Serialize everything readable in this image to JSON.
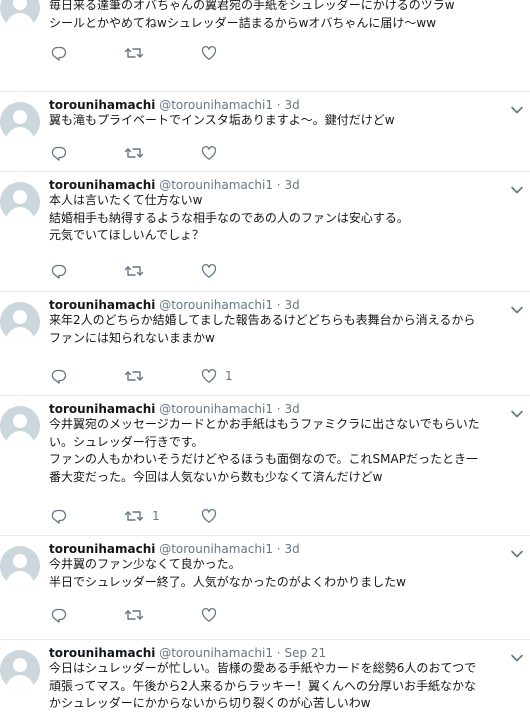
{
  "timeline": {
    "tweets": [
      {
        "name": "",
        "handle": "",
        "dot": "",
        "time": "",
        "text": "毎日来る達筆のオバちゃんの翼君宛の手紙をシュレッダーにかけるのツラw\nシールとかやめてねwシュレッダー詰まるからwオバちゃんに届け〜ww",
        "retweet_count": "",
        "like_count": ""
      },
      {
        "name": "torounihamachi",
        "handle": "@torounihamachi1",
        "dot": "·",
        "time": "3d",
        "text": "翼も滝もプライベートでインスタ垢ありますよ〜。鍵付だけどw",
        "retweet_count": "",
        "like_count": ""
      },
      {
        "name": "torounihamachi",
        "handle": "@torounihamachi1",
        "dot": "·",
        "time": "3d",
        "text": "本人は言いたくて仕方ないw\n結婚相手も納得するような相手なのであの人のファンは安心する。\n元気でいてほしいんでしょ？",
        "retweet_count": "",
        "like_count": ""
      },
      {
        "name": "torounihamachi",
        "handle": "@torounihamachi1",
        "dot": "·",
        "time": "3d",
        "text": "来年2人のどちらか結婚してました報告あるけどどちらも表舞台から消えるから\nファンには知られないままかw",
        "retweet_count": "",
        "like_count": "1"
      },
      {
        "name": "torounihamachi",
        "handle": "@torounihamachi1",
        "dot": "·",
        "time": "3d",
        "text": "今井翼宛のメッセージカードとかお手紙はもうファミクラに出さないでもらいた\nい。シュレッダー行きです。\nファンの人もかわいそうだけどやるほうも面倒なので。これSMAPだったとき一\n番大変だった。今回は人気ないから数も少なくて済んだけどw",
        "retweet_count": "1",
        "like_count": ""
      },
      {
        "name": "torounihamachi",
        "handle": "@torounihamachi1",
        "dot": "·",
        "time": "3d",
        "text": "今井翼のファン少なくて良かった。\n半日でシュレッダー終了。人気がなかったのがよくわかりましたw",
        "retweet_count": "",
        "like_count": ""
      },
      {
        "name": "torounihamachi",
        "handle": "@torounihamachi1",
        "dot": "·",
        "time": "Sep 21",
        "text": "今日はシュレッダーが忙しい。皆様の愛ある手紙やカードを総勢6人のおてつで\n頑張ってマス。午後から2人来るからラッキー！翼くんへの分厚いお手紙なかな\nかシュレッダーにかからないから切り裂くのが心苦しいわw",
        "retweet_count": "",
        "like_count": ""
      }
    ]
  },
  "colors": {
    "text": "#14171a",
    "secondary": "#657786",
    "divider": "#e6ecf0",
    "avatar_bg": "#ccd6dd"
  },
  "icons": {
    "reply": "reply-icon",
    "retweet": "retweet-icon",
    "like": "heart-icon",
    "caret": "chevron-down-icon"
  }
}
